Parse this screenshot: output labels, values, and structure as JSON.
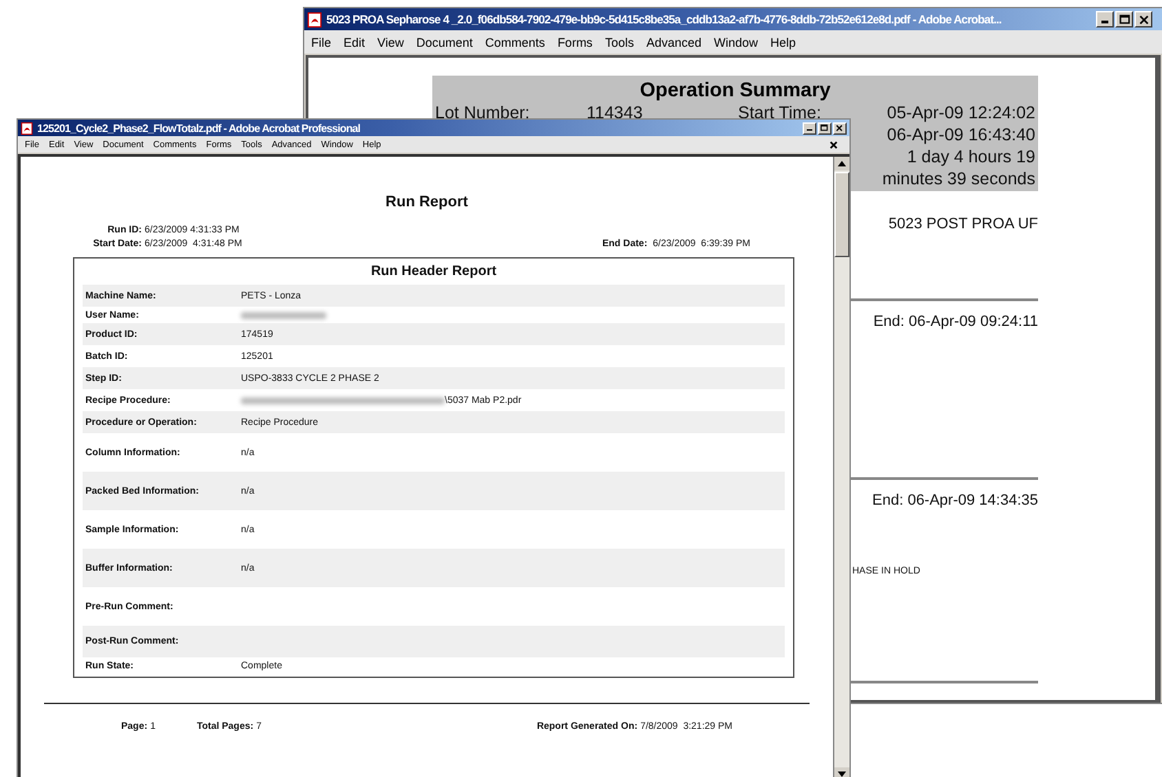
{
  "back_window": {
    "title": "5023 PROA Sepharose 4  _2.0_f06db584-7902-479e-bb9c-5d415c8be35a_cddb13a2-af7b-4776-8ddb-72b52e612e8d.pdf - Adobe Acrobat...",
    "menu": [
      "File",
      "Edit",
      "View",
      "Document",
      "Comments",
      "Forms",
      "Tools",
      "Advanced",
      "Window",
      "Help"
    ],
    "summary": {
      "title": "Operation Summary",
      "left_cells": [
        "Lot Number:",
        "114343",
        "Start Time:"
      ],
      "right_values": [
        "05-Apr-09 12:24:02",
        "06-Apr-09 16:43:40",
        "1 day 4 hours 19 minutes 39 seconds"
      ]
    },
    "sections": [
      {
        "text": "5023 POST PROA UF"
      },
      {
        "text": "End: 06-Apr-09 09:24:11"
      },
      {
        "text": "End: 06-Apr-09 14:34:35",
        "note": "HASE IN HOLD"
      }
    ]
  },
  "front_window": {
    "title": "125201_Cycle2_Phase2_FlowTotalz.pdf - Adobe Acrobat Professional",
    "menu": [
      "File",
      "Edit",
      "View",
      "Document",
      "Comments",
      "Forms",
      "Tools",
      "Advanced",
      "Window",
      "Help"
    ],
    "report": {
      "title": "Run Report",
      "run_id": {
        "label": "Run ID:",
        "value": "6/23/2009 4:31:33 PM"
      },
      "start_date": {
        "label": "Start Date:",
        "value": "6/23/2009  4:31:48 PM"
      },
      "end_date": {
        "label": "End Date:",
        "value": "6/23/2009  6:39:39 PM"
      },
      "header_title": "Run Header Report",
      "rows": [
        {
          "label": "Machine Name:",
          "value": "PETS - Lonza",
          "shaded": true,
          "blurred": false
        },
        {
          "label": "User Name:",
          "shaded": false,
          "blurred": true
        },
        {
          "label": "Product ID:",
          "value": "174519",
          "shaded": true,
          "blurred": false
        },
        {
          "label": "Batch ID:",
          "value": "125201",
          "shaded": false,
          "blurred": false
        },
        {
          "label": "Step ID:",
          "value": "USPO-3833 CYCLE 2 PHASE 2",
          "shaded": true,
          "blurred": false
        },
        {
          "label": "Recipe Procedure:",
          "value": "\\5037 Mab P2.pdr",
          "shaded": false,
          "blurred": true
        },
        {
          "label": "Procedure or Operation:",
          "value": "Recipe Procedure",
          "shaded": true,
          "blurred": false
        },
        {
          "label": "Column Information:",
          "value": "n/a",
          "shaded": false,
          "blurred": false
        },
        {
          "label": "Packed Bed Information:",
          "value": "n/a",
          "shaded": true,
          "blurred": false
        },
        {
          "label": "Sample Information:",
          "value": "n/a",
          "shaded": false,
          "blurred": false
        },
        {
          "label": "Buffer Information:",
          "value": "n/a",
          "shaded": true,
          "blurred": false
        },
        {
          "label": "Pre-Run Comment:",
          "shaded": false,
          "blurred": false
        },
        {
          "label": "Post-Run Comment:",
          "shaded": true,
          "blurred": false
        },
        {
          "label": "Run State:",
          "value": "Complete",
          "shaded": false,
          "blurred": false
        }
      ],
      "footer": [
        {
          "label": "Page:",
          "value": "1"
        },
        {
          "label": "Total Pages:",
          "value": "7"
        },
        {
          "label": "Report Generated On:",
          "value": "7/8/2009  3:21:29 PM"
        }
      ]
    }
  }
}
